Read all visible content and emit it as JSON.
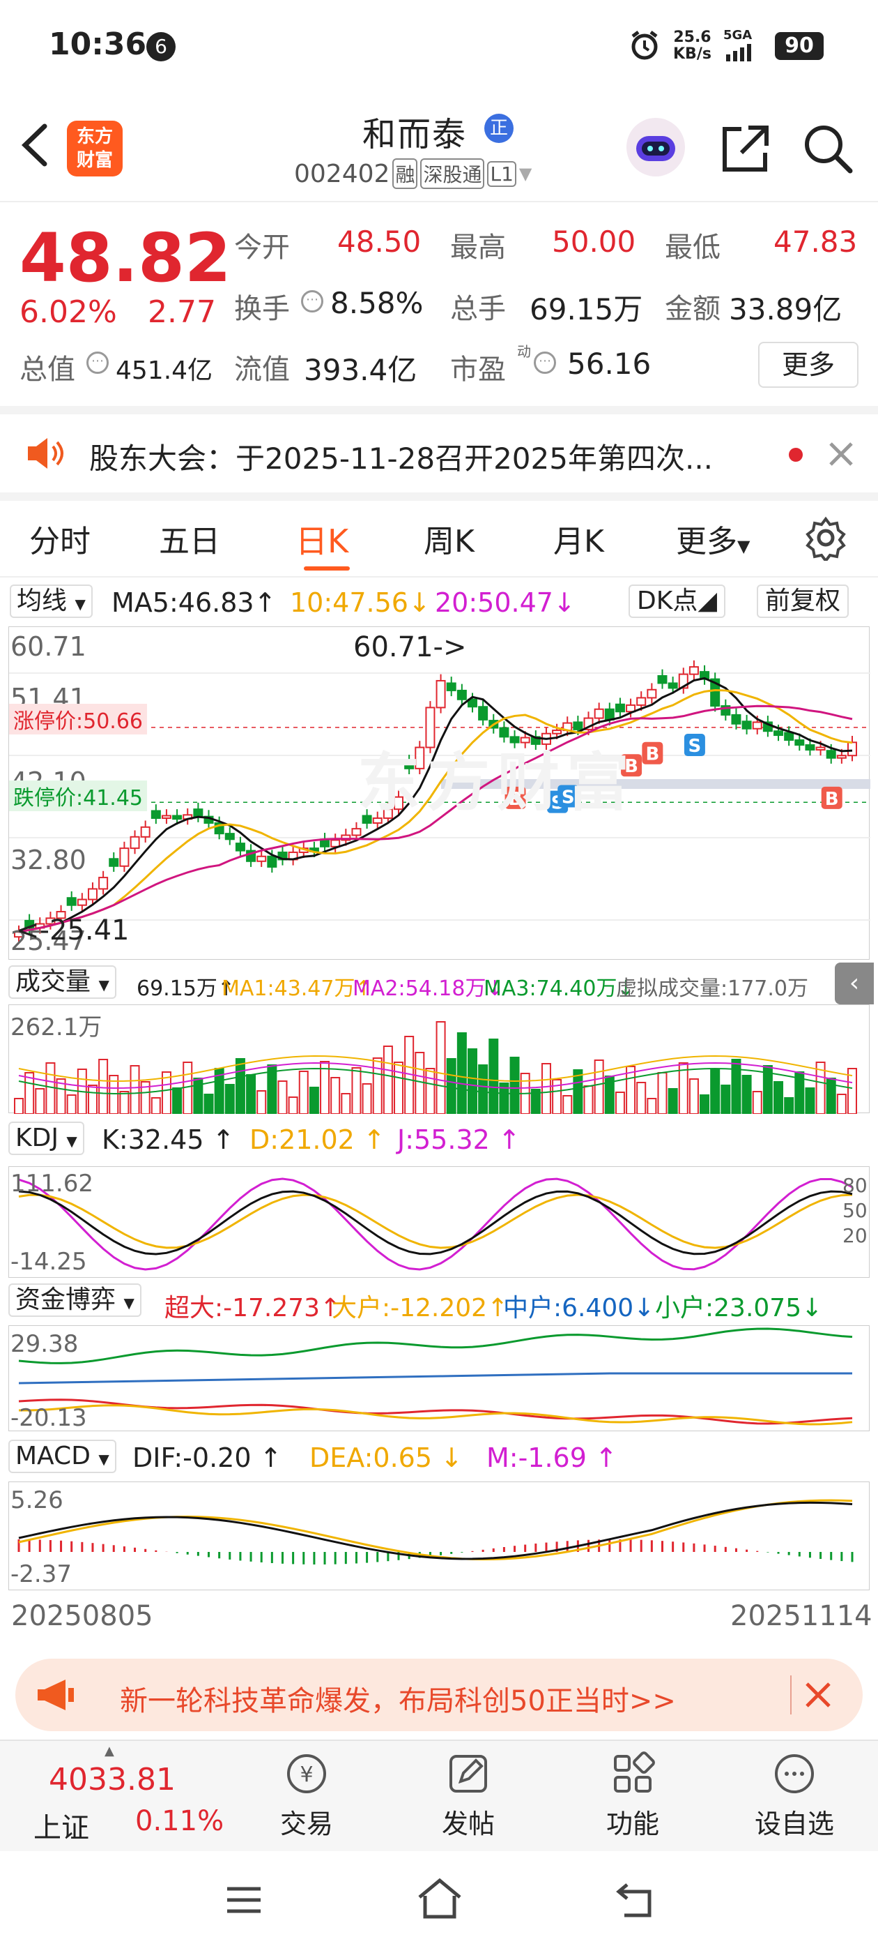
{
  "status_bar": {
    "time": "10:36",
    "notif_count": "6",
    "net_speed": "25.6",
    "net_unit": "KB/s",
    "signal": "5GA",
    "battery": "90"
  },
  "header": {
    "logo_line1": "东方",
    "logo_line2": "财富",
    "stock_name": "和而泰",
    "badge": "正",
    "code": "002402",
    "tags": [
      "融",
      "深股通",
      "L1"
    ]
  },
  "quote": {
    "price": "48.82",
    "pct": "6.02%",
    "chg": "2.77",
    "open_label": "今开",
    "open": "48.50",
    "high_label": "最高",
    "high": "50.00",
    "low_label": "最低",
    "low": "47.83",
    "turnover_label": "换手",
    "turnover": "8.58%",
    "volume_label": "总手",
    "volume": "69.15万",
    "amount_label": "金额",
    "amount": "33.89亿",
    "mcap_label": "总值",
    "mcap": "451.4亿",
    "float_label": "流值",
    "float": "393.4亿",
    "pe_label": "市盈",
    "pe_sup": "动",
    "pe": "56.16",
    "more": "更多"
  },
  "notice": {
    "text": "股东大会：于2025-11-28召开2025年第四次..."
  },
  "tabs": [
    "分时",
    "五日",
    "日K",
    "周K",
    "月K",
    "更多"
  ],
  "active_tab": 2,
  "ma_bar": {
    "selector": "均线",
    "ma5": "MA5:46.83",
    "ma10": "10:47.56",
    "ma20": "20:50.47",
    "dk": "DK点",
    "fq": "前复权"
  },
  "kchart": {
    "y_labels": [
      "60.71",
      "51.41",
      "42.10",
      "32.80",
      "25.47"
    ],
    "limit_up": "涨停价:50.66",
    "limit_down": "跌停价:41.45",
    "max_ann": "60.71->",
    "min_ann": "<-25.41",
    "watermark": "东方财富"
  },
  "vol_bar": {
    "selector": "成交量",
    "v": "69.15万",
    "ma1": "MA1:43.47万",
    "ma2": "MA2:54.18万",
    "ma3": "MA3:74.40万",
    "virt": "虚拟成交量:177.0万",
    "y_top": "262.1万"
  },
  "kdj_bar": {
    "selector": "KDJ",
    "k": "K:32.45",
    "d": "D:21.02",
    "j": "J:55.32",
    "y_top": "111.62",
    "y_bot": "-14.25",
    "r80": "80",
    "r50": "50",
    "r20": "20"
  },
  "fund_bar": {
    "selector": "资金博弈",
    "super": "超大:-17.273",
    "big": "大户:-12.202",
    "mid": "中户:6.400",
    "small": "小户:23.075",
    "y_top": "29.38",
    "y_bot": "-20.13"
  },
  "macd_bar": {
    "selector": "MACD",
    "dif": "DIF:-0.20",
    "dea": "DEA:0.65",
    "m": "M:-1.69",
    "y_top": "5.26",
    "y_bot": "-2.37"
  },
  "dates": {
    "start": "20250805",
    "end": "20251114"
  },
  "ad": {
    "text": "新一轮科技革命爆发，布局科创50正当时>>"
  },
  "bottom_nav": {
    "index_val": "4033.81",
    "index_name": "上证",
    "index_pct": "0.11%",
    "items": [
      "交易",
      "发帖",
      "功能",
      "设自选"
    ]
  }
}
